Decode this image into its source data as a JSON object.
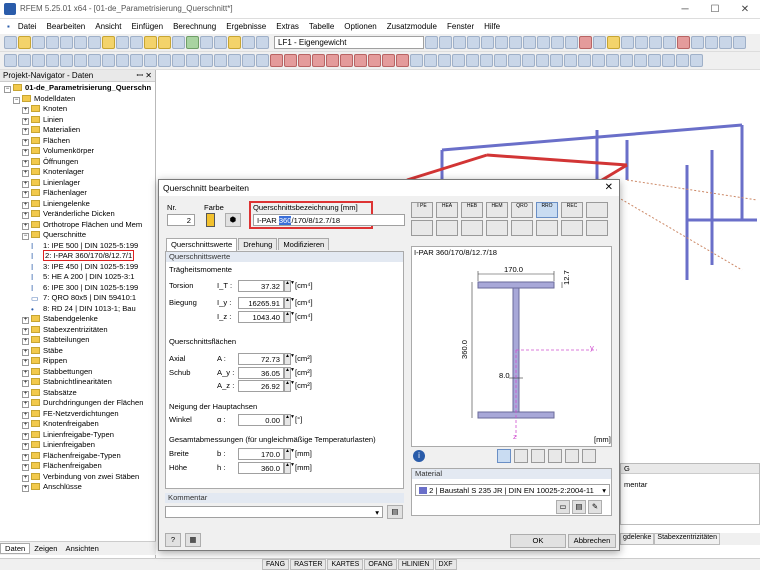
{
  "window": {
    "title": "RFEM 5.25.01 x64 - [01-de_Parametrisierung_Querschnitt*]"
  },
  "menu": [
    "Datei",
    "Bearbeiten",
    "Ansicht",
    "Einfügen",
    "Berechnung",
    "Ergebnisse",
    "Extras",
    "Tabelle",
    "Optionen",
    "Zusatzmodule",
    "Fenster",
    "Hilfe"
  ],
  "toolbar": {
    "loadcase": "LF1 - Eigengewicht"
  },
  "navigator": {
    "title": "Projekt-Navigator - Daten",
    "pin": "ꟷ ✕",
    "items": [
      {
        "level": 0,
        "icon": "folder",
        "text": "01-de_Parametrisierung_Querschn",
        "bold": true
      },
      {
        "level": 1,
        "icon": "folder",
        "text": "Modelldaten"
      },
      {
        "level": 2,
        "icon": "folder",
        "text": "Knoten"
      },
      {
        "level": 2,
        "icon": "folder",
        "text": "Linien"
      },
      {
        "level": 2,
        "icon": "folder",
        "text": "Materialien"
      },
      {
        "level": 2,
        "icon": "folder",
        "text": "Flächen"
      },
      {
        "level": 2,
        "icon": "folder",
        "text": "Volumenkörper"
      },
      {
        "level": 2,
        "icon": "folder",
        "text": "Öffnungen"
      },
      {
        "level": 2,
        "icon": "folder",
        "text": "Knotenlager"
      },
      {
        "level": 2,
        "icon": "folder",
        "text": "Linienlager"
      },
      {
        "level": 2,
        "icon": "folder",
        "text": "Flächenlager"
      },
      {
        "level": 2,
        "icon": "folder",
        "text": "Liniengelenke"
      },
      {
        "level": 2,
        "icon": "folder",
        "text": "Veränderliche Dicken"
      },
      {
        "level": 2,
        "icon": "folder",
        "text": "Orthotrope Flächen und Mem"
      },
      {
        "level": 2,
        "icon": "folder",
        "text": "Querschnitte"
      },
      {
        "level": 3,
        "icon": "I",
        "text": "1: IPE 500 | DIN 1025-5:199"
      },
      {
        "level": 3,
        "icon": "I",
        "text": "2: I-PAR 360/170/8/12.7/1",
        "selected": true
      },
      {
        "level": 3,
        "icon": "I",
        "text": "3: IPE 450 | DIN 1025-5:199"
      },
      {
        "level": 3,
        "icon": "I",
        "text": "5: HE A 200 | DIN 1025-3:1"
      },
      {
        "level": 3,
        "icon": "I",
        "text": "6: IPE 300 | DIN 1025-5:199"
      },
      {
        "level": 3,
        "icon": "▭",
        "text": "7: QRO 80x5 | DIN 59410:1"
      },
      {
        "level": 3,
        "icon": "•",
        "text": "8: RD 24 | DIN 1013-1; Bau"
      },
      {
        "level": 2,
        "icon": "folder",
        "text": "Stabendgelenke"
      },
      {
        "level": 2,
        "icon": "folder",
        "text": "Stabexzentrizitäten"
      },
      {
        "level": 2,
        "icon": "folder",
        "text": "Stabteilungen"
      },
      {
        "level": 2,
        "icon": "folder",
        "text": "Stäbe"
      },
      {
        "level": 2,
        "icon": "folder",
        "text": "Rippen"
      },
      {
        "level": 2,
        "icon": "folder",
        "text": "Stabbettungen"
      },
      {
        "level": 2,
        "icon": "folder",
        "text": "Stabnichtlinearitäten"
      },
      {
        "level": 2,
        "icon": "folder",
        "text": "Stabsätze"
      },
      {
        "level": 2,
        "icon": "folder",
        "text": "Durchdringungen der Flächen"
      },
      {
        "level": 2,
        "icon": "folder",
        "text": "FE-Netzverdichtungen"
      },
      {
        "level": 2,
        "icon": "folder",
        "text": "Knotenfreigaben"
      },
      {
        "level": 2,
        "icon": "folder",
        "text": "Linienfreigabe-Typen"
      },
      {
        "level": 2,
        "icon": "folder",
        "text": "Linienfreigaben"
      },
      {
        "level": 2,
        "icon": "folder",
        "text": "Flächenfreigabe-Typen"
      },
      {
        "level": 2,
        "icon": "folder",
        "text": "Flächenfreigaben"
      },
      {
        "level": 2,
        "icon": "folder",
        "text": "Verbindung von zwei Stäben"
      },
      {
        "level": 2,
        "icon": "folder",
        "text": "Anschlüsse"
      }
    ],
    "tabs": [
      "Daten",
      "Zeigen",
      "Ansichten"
    ]
  },
  "statusbar": [
    "FANG",
    "RASTER",
    "KARTES",
    "OFANG",
    "HLINIEN",
    "DXF"
  ],
  "bottom_tabs": [
    "gdelenke",
    "Stabexzentrizitäten"
  ],
  "right_panel": {
    "col": "G",
    "row": "mentar"
  },
  "dialog": {
    "title": "Querschnitt bearbeiten",
    "nr_label": "Nr.",
    "nr": "2",
    "farbe_label": "Farbe",
    "name_label": "Querschnittsbezeichnung [mm]",
    "name_pre": "I-PAR ",
    "name_sel": "360",
    "name_post": "/170/8/12.7/18",
    "tabs": [
      "Querschnittswerte",
      "Drehung",
      "Modifizieren"
    ],
    "sections": {
      "qw": "Querschnittswerte",
      "tm": "Trägheitsmomente",
      "qf": "Querschnittsflächen",
      "nh": "Neigung der Hauptachsen",
      "ga": "Gesamtabmessungen (für ungleichmäßige Temperaturlasten)"
    },
    "rows": [
      {
        "label": "Torsion",
        "sym": "I_T :",
        "value": "37.32",
        "unit": "[cm⁴]"
      },
      {
        "label": "Biegung",
        "sym": "I_y :",
        "value": "16265.91",
        "unit": "[cm⁴]"
      },
      {
        "label": "",
        "sym": "I_z :",
        "value": "1043.40",
        "unit": "[cm⁴]"
      },
      {
        "label": "Axial",
        "sym": "A :",
        "value": "72.73",
        "unit": "[cm²]"
      },
      {
        "label": "Schub",
        "sym": "A_y :",
        "value": "36.05",
        "unit": "[cm²]"
      },
      {
        "label": "",
        "sym": "A_z :",
        "value": "26.92",
        "unit": "[cm²]"
      },
      {
        "label": "Winkel",
        "sym": "α :",
        "value": "0.00",
        "unit": "[°]"
      },
      {
        "label": "Breite",
        "sym": "b :",
        "value": "170.0",
        "unit": "[mm]"
      },
      {
        "label": "Höhe",
        "sym": "h :",
        "value": "360.0",
        "unit": "[mm]"
      }
    ],
    "kommentar_label": "Kommentar",
    "profile_buttons": [
      "I PE",
      "HEA",
      "HEB",
      "HEM",
      "QRO",
      "RRO",
      "REC",
      "",
      "",
      "",
      "",
      "",
      "",
      "",
      "",
      ""
    ],
    "preview": {
      "caption": "I-PAR 360/170/8/12.7/18",
      "b": "170.0",
      "tf": "12.7",
      "h": "360.0",
      "tw": "8.0",
      "unit": "[mm]",
      "axis_y": "y",
      "axis_z": "z"
    },
    "material_label": "Material",
    "material_nr": "2",
    "material": "Baustahl S 235 JR",
    "material_norm": "DIN EN 10025-2:2004-11",
    "ok": "OK",
    "cancel": "Abbrechen"
  }
}
